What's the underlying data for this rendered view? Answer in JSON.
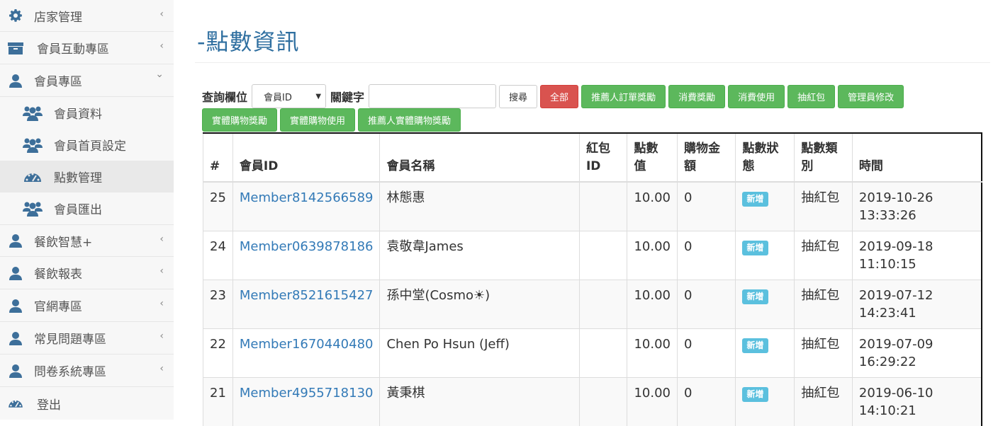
{
  "sidebar": {
    "items": [
      {
        "label": "店家管理",
        "icon": "gear-icon",
        "expanded": false
      },
      {
        "label": "會員互動專區",
        "icon": "archive-icon",
        "expanded": false
      },
      {
        "label": "會員專區",
        "icon": "user-icon",
        "expanded": true,
        "children": [
          {
            "label": "會員資料",
            "icon": "users-icon"
          },
          {
            "label": "會員首頁設定",
            "icon": "users-icon"
          },
          {
            "label": "點數管理",
            "icon": "dashboard-icon",
            "active": true
          },
          {
            "label": "會員匯出",
            "icon": "users-icon"
          }
        ]
      },
      {
        "label": "餐飲智慧+",
        "icon": "user-icon",
        "expanded": false
      },
      {
        "label": "餐飲報表",
        "icon": "user-icon",
        "expanded": false
      },
      {
        "label": "官網專區",
        "icon": "user-icon",
        "expanded": false
      },
      {
        "label": "常見問題專區",
        "icon": "user-icon",
        "expanded": false
      },
      {
        "label": "問卷系統專區",
        "icon": "user-icon",
        "expanded": false
      },
      {
        "label": "登出",
        "icon": "dashboard-icon"
      }
    ],
    "chevron_left": "‹",
    "chevron_down": "⌄"
  },
  "page": {
    "title": "-點數資訊"
  },
  "search": {
    "field_label": "查詢欄位",
    "field_value": "會員ID",
    "keyword_label": "關鍵字",
    "keyword_value": "",
    "search_button": "搜尋"
  },
  "filters": [
    "全部",
    "推薦人訂單獎勵",
    "消費獎勵",
    "消費使用",
    "抽紅包",
    "管理員修改",
    "實體購物獎勵",
    "實體購物使用",
    "推薦人實體購物獎勵"
  ],
  "table": {
    "headers": [
      "#",
      "會員ID",
      "會員名稱",
      "紅包ID",
      "點數值",
      "購物金額",
      "點數狀態",
      "點數類別",
      "時間"
    ],
    "header_lines": [
      [
        "#"
      ],
      [
        "會員ID"
      ],
      [
        "會員名稱"
      ],
      [
        "紅包",
        "ID"
      ],
      [
        "點數",
        "值"
      ],
      [
        "購物金",
        "額"
      ],
      [
        "點數狀",
        "態"
      ],
      [
        "點數類",
        "別"
      ],
      [
        "時間"
      ]
    ],
    "rows": [
      {
        "no": "25",
        "member_id": "Member8142566589",
        "name": "林態惠",
        "red_id": "",
        "points": "10.00",
        "amount": "0",
        "status": "新增",
        "category": "抽紅包",
        "date": "2019-10-26",
        "time": "13:33:26"
      },
      {
        "no": "24",
        "member_id": "Member0639878186",
        "name": "袁敬韋James",
        "red_id": "",
        "points": "10.00",
        "amount": "0",
        "status": "新增",
        "category": "抽紅包",
        "date": "2019-09-18",
        "time": "11:10:15"
      },
      {
        "no": "23",
        "member_id": "Member8521615427",
        "name": "孫中堂(Cosmo☀)",
        "red_id": "",
        "points": "10.00",
        "amount": "0",
        "status": "新增",
        "category": "抽紅包",
        "date": "2019-07-12",
        "time": "14:23:41"
      },
      {
        "no": "22",
        "member_id": "Member1670440480",
        "name": "Chen Po Hsun (Jeff)",
        "red_id": "",
        "points": "10.00",
        "amount": "0",
        "status": "新增",
        "category": "抽紅包",
        "date": "2019-07-09",
        "time": "16:29:22"
      },
      {
        "no": "21",
        "member_id": "Member4955718130",
        "name": "黃秉棋",
        "red_id": "",
        "points": "10.00",
        "amount": "0",
        "status": "新增",
        "category": "抽紅包",
        "date": "2019-06-10",
        "time": "14:10:21"
      }
    ]
  },
  "colors": {
    "accent": "#2f6fa0",
    "link": "#337ab7",
    "danger": "#d9534f",
    "success": "#5cb85c",
    "info": "#5bc0de"
  }
}
